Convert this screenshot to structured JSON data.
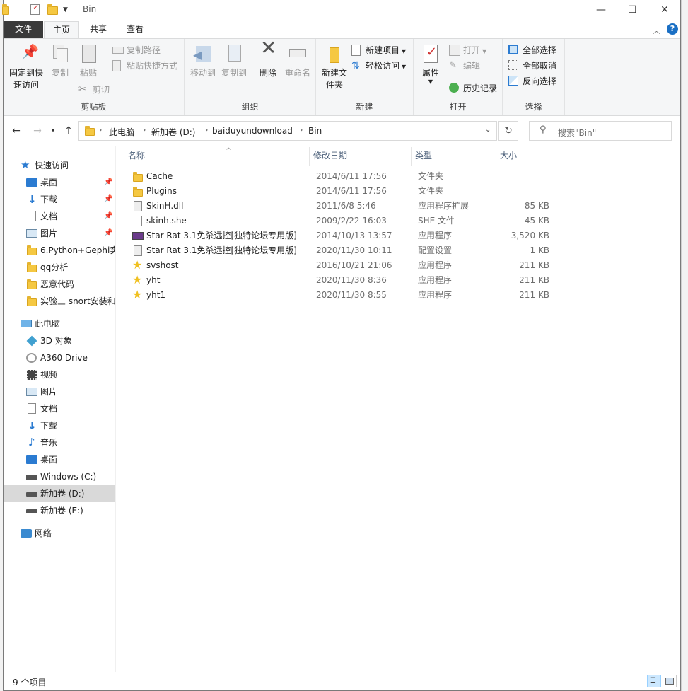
{
  "window": {
    "title": "Bin",
    "controls": {
      "minimize": "—",
      "maximize": "☐",
      "close": "✕"
    }
  },
  "ribbon_tabs": [
    {
      "label": "文件"
    },
    {
      "label": "主页"
    },
    {
      "label": "共享"
    },
    {
      "label": "查看"
    }
  ],
  "ribbon": {
    "clipboard": {
      "group_label": "剪贴板",
      "pin_quick_access": "固定到快速访问",
      "copy": "复制",
      "paste": "粘贴",
      "copy_path": "复制路径",
      "paste_shortcut": "粘贴快捷方式",
      "cut": "剪切"
    },
    "organize": {
      "group_label": "组织",
      "move_to": "移动到",
      "copy_to": "复制到",
      "delete": "删除",
      "rename": "重命名"
    },
    "new": {
      "group_label": "新建",
      "new_folder": "新建文件夹",
      "new_item": "新建项目",
      "easy_access": "轻松访问"
    },
    "open": {
      "group_label": "打开",
      "properties": "属性",
      "open": "打开",
      "edit": "编辑",
      "history": "历史记录"
    },
    "select": {
      "group_label": "选择",
      "select_all": "全部选择",
      "select_none": "全部取消",
      "invert": "反向选择"
    }
  },
  "address": {
    "crumbs": [
      "此电脑",
      "新加卷 (D:)",
      "baiduyundownload",
      "Bin"
    ],
    "search_placeholder": "搜索\"Bin\""
  },
  "nav_pane": {
    "quick_access": "快速访问",
    "quick_items": [
      {
        "label": "桌面",
        "pinned": true
      },
      {
        "label": "下载",
        "pinned": true
      },
      {
        "label": "文档",
        "pinned": true
      },
      {
        "label": "图片",
        "pinned": true
      },
      {
        "label": "6.Python+Gephi实",
        "pinned": false
      },
      {
        "label": "qq分析",
        "pinned": false
      },
      {
        "label": "恶意代码",
        "pinned": false
      },
      {
        "label": "实验三 snort安装和",
        "pinned": false
      }
    ],
    "this_pc": "此电脑",
    "pc_items": [
      {
        "label": "3D 对象"
      },
      {
        "label": "A360 Drive"
      },
      {
        "label": "视频"
      },
      {
        "label": "图片"
      },
      {
        "label": "文档"
      },
      {
        "label": "下载"
      },
      {
        "label": "音乐"
      },
      {
        "label": "桌面"
      },
      {
        "label": "Windows (C:)"
      },
      {
        "label": "新加卷 (D:)"
      },
      {
        "label": "新加卷 (E:)"
      }
    ],
    "network": "网络"
  },
  "file_list": {
    "columns": {
      "name": "名称",
      "date": "修改日期",
      "type": "类型",
      "size": "大小"
    },
    "rows": [
      {
        "name": "Cache",
        "date": "2014/6/11 17:56",
        "type": "文件夹",
        "size": "",
        "icon": "folder-icon"
      },
      {
        "name": "Plugins",
        "date": "2014/6/11 17:56",
        "type": "文件夹",
        "size": "",
        "icon": "folder-icon"
      },
      {
        "name": "SkinH.dll",
        "date": "2011/6/8 5:46",
        "type": "应用程序扩展",
        "size": "85 KB",
        "icon": "dll-icon"
      },
      {
        "name": "skinh.she",
        "date": "2009/2/22 16:03",
        "type": "SHE 文件",
        "size": "45 KB",
        "icon": "file-icon"
      },
      {
        "name": "Star Rat 3.1免杀远控[独特论坛专用版]",
        "date": "2014/10/13 13:57",
        "type": "应用程序",
        "size": "3,520 KB",
        "icon": "app-monitor-icon"
      },
      {
        "name": "Star Rat 3.1免杀远控[独特论坛专用版]",
        "date": "2020/11/30 10:11",
        "type": "配置设置",
        "size": "1 KB",
        "icon": "config-icon"
      },
      {
        "name": "svshost",
        "date": "2016/10/21 21:06",
        "type": "应用程序",
        "size": "211 KB",
        "icon": "star-icon"
      },
      {
        "name": "yht",
        "date": "2020/11/30 8:36",
        "type": "应用程序",
        "size": "211 KB",
        "icon": "star-icon"
      },
      {
        "name": "yht1",
        "date": "2020/11/30 8:55",
        "type": "应用程序",
        "size": "211 KB",
        "icon": "star-icon"
      }
    ]
  },
  "status": {
    "count": "9 个项目"
  }
}
